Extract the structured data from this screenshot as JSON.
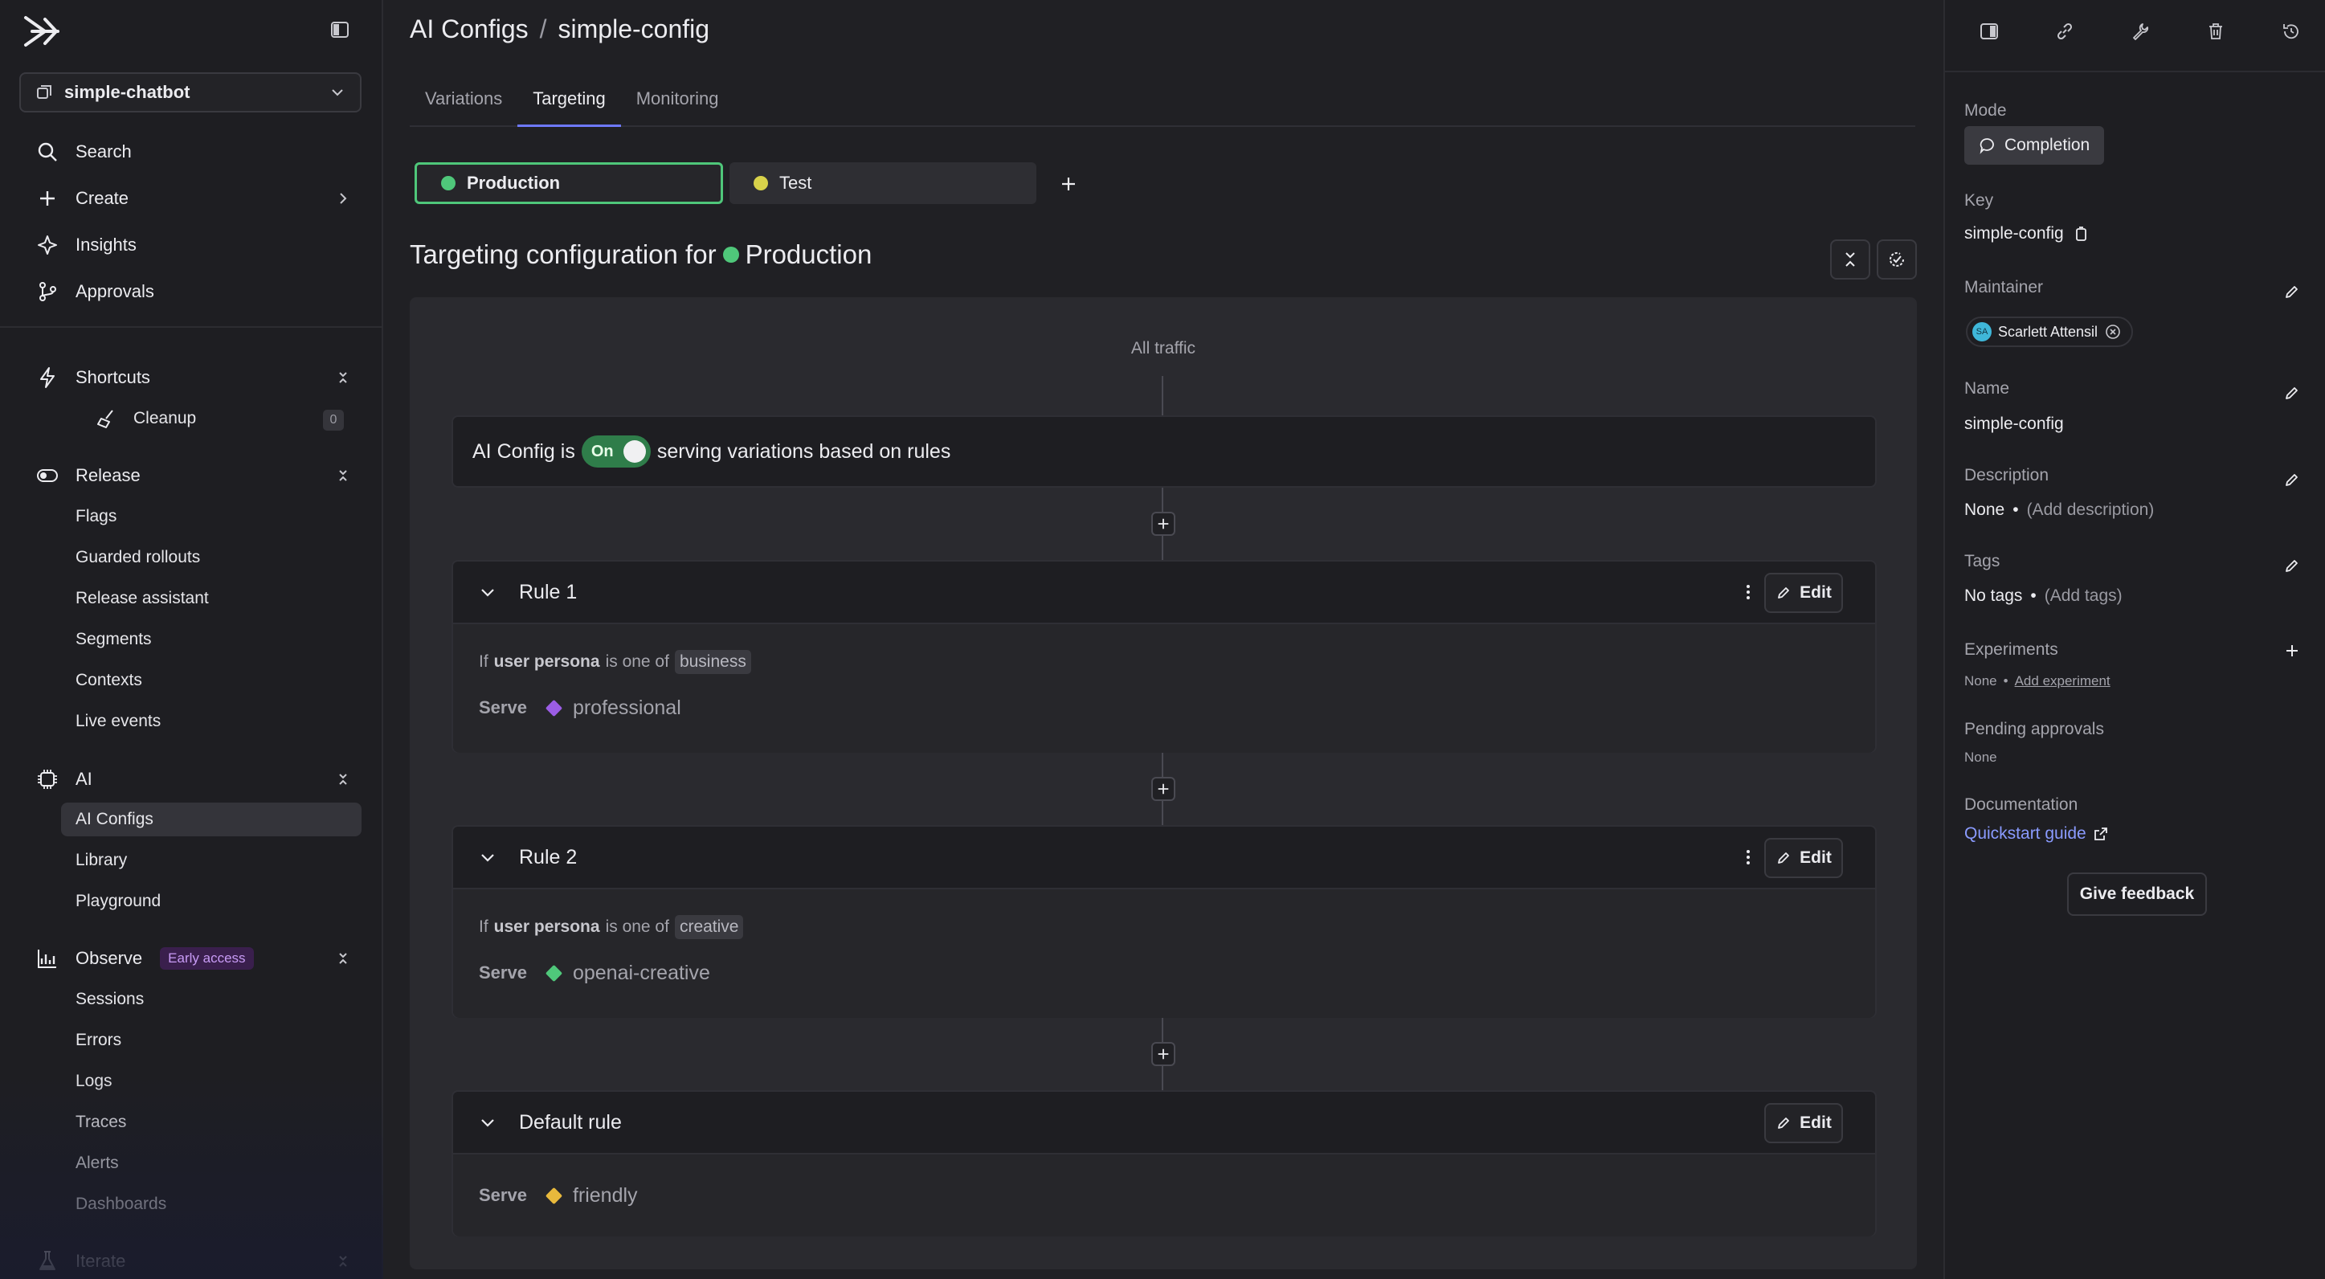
{
  "sidebar": {
    "project": "simple-chatbot",
    "nav": [
      {
        "label": "Search",
        "icon": "search-icon"
      },
      {
        "label": "Create",
        "icon": "plus-icon"
      },
      {
        "label": "Insights",
        "icon": "sparkle-icon"
      },
      {
        "label": "Approvals",
        "icon": "branch-icon"
      }
    ],
    "shortcuts": {
      "label": "Shortcuts",
      "items": [
        {
          "label": "Cleanup",
          "count": "0"
        }
      ]
    },
    "release": {
      "label": "Release",
      "items": [
        "Flags",
        "Guarded rollouts",
        "Release assistant",
        "Segments",
        "Contexts",
        "Live events"
      ]
    },
    "ai": {
      "label": "AI",
      "items": [
        "AI Configs",
        "Library",
        "Playground"
      ],
      "active": "AI Configs"
    },
    "observe": {
      "label": "Observe",
      "badge": "Early access",
      "items": [
        "Sessions",
        "Errors",
        "Logs",
        "Traces",
        "Alerts",
        "Dashboards"
      ]
    },
    "iterate": {
      "label": "Iterate"
    }
  },
  "header": {
    "breadcrumb_root": "AI Configs",
    "separator": "/",
    "breadcrumb_current": "simple-config"
  },
  "tabs": [
    {
      "label": "Variations",
      "active": false
    },
    {
      "label": "Targeting",
      "active": true
    },
    {
      "label": "Monitoring",
      "active": false
    }
  ],
  "environments": [
    {
      "name": "Production",
      "color": "#4fc77a",
      "selected": true
    },
    {
      "name": "Test",
      "color": "#d8d24a",
      "selected": false
    }
  ],
  "targeting": {
    "title_prefix": "Targeting configuration for",
    "environment": "Production",
    "all_traffic": "All traffic",
    "status_prefix": "AI Config is",
    "toggle_label": "On",
    "status_suffix": "serving variations based on rules",
    "rules": [
      {
        "title": "Rule 1",
        "cond_if": "If",
        "attribute": "user persona",
        "operator": "is one of",
        "value": "business",
        "serve_label": "Serve",
        "variation": "professional",
        "variation_color": "#9b5de5"
      },
      {
        "title": "Rule 2",
        "cond_if": "If",
        "attribute": "user persona",
        "operator": "is one of",
        "value": "creative",
        "serve_label": "Serve",
        "variation": "openai-creative",
        "variation_color": "#4fc77a"
      }
    ],
    "default_rule": {
      "title": "Default rule",
      "serve_label": "Serve",
      "variation": "friendly",
      "variation_color": "#e8b93c"
    },
    "edit_label": "Edit"
  },
  "details": {
    "mode_label": "Mode",
    "mode_value": "Completion",
    "key_label": "Key",
    "key_value": "simple-config",
    "maintainer_label": "Maintainer",
    "maintainer_initials": "SA",
    "maintainer_name": "Scarlett Attensil",
    "name_label": "Name",
    "name_value": "simple-config",
    "description_label": "Description",
    "description_value": "None",
    "description_add": "(Add description)",
    "tags_label": "Tags",
    "tags_value": "No tags",
    "tags_add": "(Add tags)",
    "experiments_label": "Experiments",
    "experiments_value": "None",
    "experiments_add": "Add experiment",
    "pending_label": "Pending approvals",
    "pending_value": "None",
    "documentation_label": "Documentation",
    "documentation_link": "Quickstart guide",
    "feedback": "Give feedback",
    "bullet": "•"
  }
}
